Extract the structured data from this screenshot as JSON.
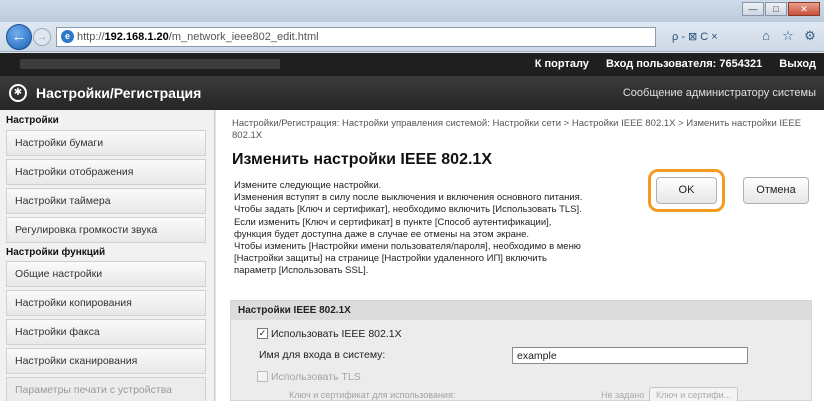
{
  "browser": {
    "url_prefix": "http://",
    "url_host": "192.168.1.20",
    "url_path": "/m_network_ieee802_edit.html",
    "search_hint": "ρ - ⊠ C ×",
    "window_min": "—",
    "window_max": "□",
    "window_close": "✕"
  },
  "topbar": {
    "portal_link": "К порталу",
    "login_user": "Вход пользователя: 7654321",
    "logout": "Выход"
  },
  "header": {
    "app_title": "Настройки/Регистрация",
    "admin_message": "Сообщение администратору системы"
  },
  "sidebar": {
    "section1_title": "Настройки",
    "items1": [
      "Настройки бумаги",
      "Настройки отображения",
      "Настройки таймера",
      "Регулировка громкости звука"
    ],
    "section2_title": "Настройки функций",
    "items2": [
      "Общие настройки",
      "Настройки копирования",
      "Настройки факса",
      "Настройки сканирования",
      "Параметры печати с устройства"
    ]
  },
  "main": {
    "breadcrumb": "Настройки/Регистрация: Настройки управления системой: Настройки сети > Настройки IEEE 802.1X > Изменить настройки IEEE 802.1X",
    "title": "Изменить настройки IEEE 802.1X",
    "description": [
      "Измените следующие настройки.",
      "Изменения вступят в силу после выключения и включения основного питания.",
      "Чтобы задать [Ключ и сертификат], необходимо включить [Использовать TLS].",
      "Если изменить [Ключ и сертификат] в пункте [Способ аутентификации],",
      "функция будет доступна даже в случае ее отмены на этом экране.",
      "Чтобы изменить [Настройки имени пользователя/пароля], необходимо в меню",
      "[Настройки защиты] на странице [Настройки удаленного ИП] включить",
      "параметр [Использовать SSL]."
    ],
    "ok_label": "OK",
    "cancel_label": "Отмена"
  },
  "ieee_section": {
    "heading": "Настройки IEEE 802.1X",
    "use_ieee_label": "Использовать IEEE 802.1X",
    "use_ieee_checked": true,
    "login_name_label": "Имя для входа в систему:",
    "login_name_value": "example",
    "use_tls_label": "Использовать TLS",
    "use_tls_checked": false,
    "key_label": "Ключ и сертификат для использования:",
    "key_status": "Не задано",
    "key_button": "Ключ и сертифи..."
  },
  "colors": {
    "highlight": "#f59b1f",
    "header_dark": "#262626",
    "sidebar_bg": "#f1f1f1"
  }
}
